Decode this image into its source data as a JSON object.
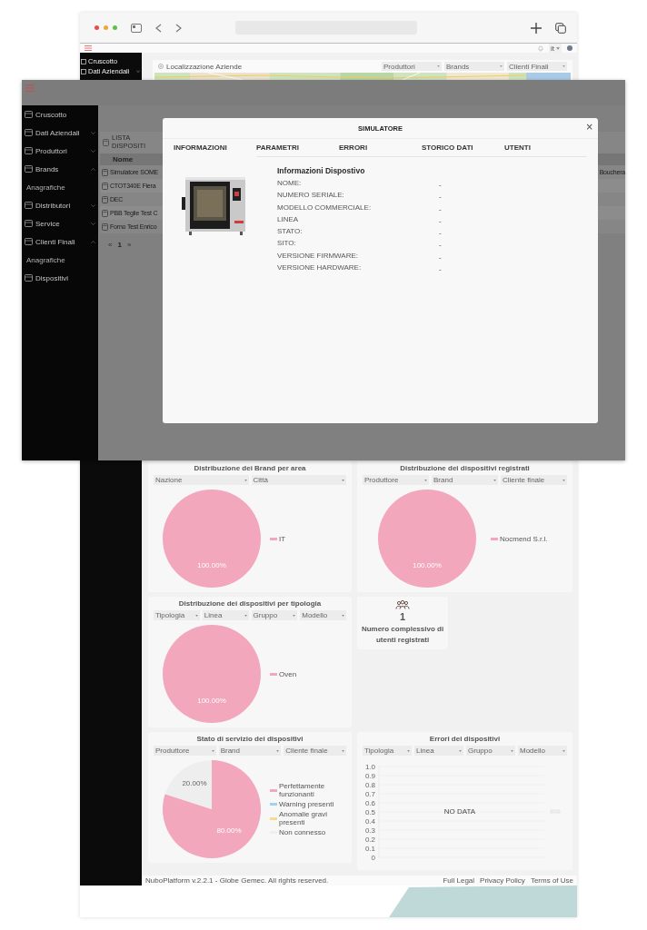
{
  "back_app": {
    "header": {
      "language": "it"
    },
    "sidebar": {
      "items": [
        {
          "label": "Cruscotto",
          "kind": "link"
        },
        {
          "label": "Dati Aziendali",
          "kind": "group",
          "expanded": false
        }
      ]
    },
    "map_card": {
      "title": "Localizzazione Aziende",
      "filters": [
        {
          "placeholder": "Produttori"
        },
        {
          "placeholder": "Brands"
        },
        {
          "placeholder": "Clienti Finali"
        }
      ]
    },
    "cards": [
      {
        "kind": "pie",
        "filters": [
          {
            "placeholder": "Nazione"
          },
          {
            "placeholder": "Città"
          }
        ],
        "chart_data": {
          "type": "pie",
          "title": "Distribuzione dei Brand per area",
          "categories": [
            "IT"
          ],
          "values": [
            1
          ],
          "value_labels": [
            "100.00%"
          ],
          "data_labels": true,
          "legend": "right"
        }
      },
      {
        "kind": "pie",
        "filters": [
          {
            "placeholder": "Produttore"
          },
          {
            "placeholder": "Brand"
          },
          {
            "placeholder": "Cliente finale"
          }
        ],
        "chart_data": {
          "type": "pie",
          "title": "Distribuzione dei dispositivi registrati",
          "categories": [
            "Nocmend S.r.l."
          ],
          "values": [
            1
          ],
          "value_labels": [
            "100.00%"
          ],
          "data_labels": true,
          "legend": "right"
        }
      },
      {
        "kind": "pie",
        "filters": [
          {
            "placeholder": "Tipologia"
          },
          {
            "placeholder": "Linea"
          },
          {
            "placeholder": "Gruppo"
          },
          {
            "placeholder": "Modello"
          }
        ],
        "chart_data": {
          "type": "pie",
          "title": "Distribuzione dei dispositivi per tipologia",
          "categories": [
            "Oven"
          ],
          "values": [
            1
          ],
          "value_labels": [
            "100.00%"
          ],
          "data_labels": true,
          "legend": "right"
        }
      },
      {
        "kind": "stat",
        "value": "1",
        "label": "Numero complessivo di utenti registrati"
      },
      {
        "kind": "pie",
        "filters": [
          {
            "placeholder": "Produttore"
          },
          {
            "placeholder": "Brand"
          },
          {
            "placeholder": "Cliente finale"
          }
        ],
        "chart_data": {
          "type": "pie",
          "title": "Stato di servizio dei dispositivi",
          "categories": [
            "Perfettamente funzionanti",
            "Warning presenti",
            "Anomalie gravi presenti",
            "Non connesso"
          ],
          "values": [
            0.8,
            0,
            0,
            0.2
          ],
          "value_labels": [
            "80.00%",
            null,
            null,
            "20.00%"
          ],
          "data_labels": true,
          "legend": "right"
        }
      },
      {
        "kind": "line",
        "message": "NO DATA",
        "filters": [
          {
            "placeholder": "Tipologia"
          },
          {
            "placeholder": "Linea"
          },
          {
            "placeholder": "Gruppo"
          },
          {
            "placeholder": "Modello"
          }
        ],
        "title": "Errori dei dispositivi",
        "y_axis_labels": [
          "1.0",
          "0.9",
          "0.8",
          "0.7",
          "0.6",
          "0.5",
          "0.4",
          "0.3",
          "0.2",
          "0.1",
          "0"
        ]
      }
    ],
    "footer": {
      "copyright": "NuboPlatform v.2.2.1 - Globe Gemec. All rights reserved.",
      "links": [
        "Full Legal",
        "Privacy Policy",
        "Terms of Use"
      ]
    }
  },
  "front_app": {
    "sidebar": {
      "items": [
        {
          "label": "Cruscotto",
          "kind": "link"
        },
        {
          "label": "Dati Aziendali",
          "kind": "group",
          "expanded": false
        },
        {
          "label": "Produttori",
          "kind": "group",
          "expanded": false
        },
        {
          "label": "Brands",
          "kind": "group",
          "expanded": true,
          "children": [
            {
              "label": "Anagrafiche"
            }
          ]
        },
        {
          "label": "Distributori",
          "kind": "group",
          "expanded": false
        },
        {
          "label": "Service",
          "kind": "group",
          "expanded": false
        },
        {
          "label": "Clienti Finali",
          "kind": "group",
          "expanded": true,
          "children": [
            {
              "label": "Anagrafiche"
            }
          ]
        },
        {
          "label": "Dispositivi",
          "kind": "link"
        }
      ]
    },
    "device_list": {
      "title": "LISTA DISPOSITI",
      "columns": [
        "Nome"
      ],
      "rows": [
        {
          "name": "Simulatore SOME",
          "column_2": "Bouchera"
        },
        {
          "name": "CTOT340E Fiera"
        },
        {
          "name": "DEC"
        },
        {
          "name": "PBB Teglie Test C"
        },
        {
          "name": "Forno Test Enrico"
        }
      ],
      "pagination": [
        {
          "label": "«",
          "selected": false
        },
        {
          "label": "1",
          "selected": true
        },
        {
          "label": "»",
          "selected": false
        }
      ]
    },
    "modal": {
      "title": "SIMULATORE",
      "close": "×",
      "tabs": [
        {
          "label": "INFORMAZIONI",
          "selected": true
        },
        {
          "label": "PARAMETRI",
          "selected": false
        },
        {
          "label": "ERRORI",
          "selected": false
        },
        {
          "label": "STORICO DATI",
          "selected": false
        },
        {
          "label": "UTENTI",
          "selected": false
        }
      ],
      "section_title": "Informazioni Dispostivo",
      "fields": [
        {
          "label": "NOME:",
          "value": "-"
        },
        {
          "label": "NUMERO SERIALE:",
          "value": "-"
        },
        {
          "label": "MODELLO COMMERCIALE:",
          "value": "-"
        },
        {
          "label": "LINEA",
          "value": "-"
        },
        {
          "label": "STATO:",
          "value": "-"
        },
        {
          "label": "SITO:",
          "value": "-"
        },
        {
          "label": "VERSIONE FIRMWARE:",
          "value": "-"
        },
        {
          "label": "VERSIONE HARDWARE:",
          "value": "-"
        }
      ]
    }
  }
}
